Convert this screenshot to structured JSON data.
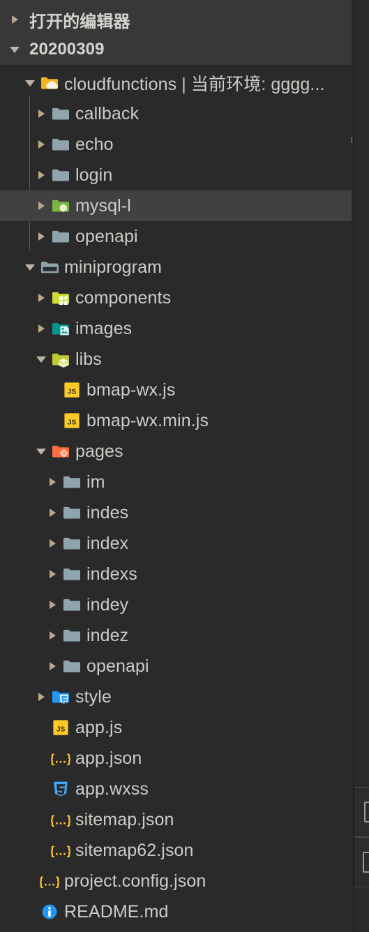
{
  "theme": {
    "sidebar_bg": "#2a2a2a",
    "header_bg": "#383838",
    "selected_bg": "#414141",
    "text": "#ccccc7",
    "guide": "#585858",
    "twisty": "#b9a88f"
  },
  "sections": [
    {
      "label": "打开的编辑器",
      "expanded": false
    },
    {
      "label": "20200309",
      "expanded": true
    }
  ],
  "tree": [
    {
      "label": "cloudfunctions | 当前环境: gggg...",
      "icon": "folder-cloud-icon",
      "state": "expanded",
      "depth": 1,
      "selected": false
    },
    {
      "label": "callback",
      "icon": "folder-icon",
      "state": "collapsed",
      "depth": 2,
      "selected": false
    },
    {
      "label": "echo",
      "icon": "folder-icon",
      "state": "collapsed",
      "depth": 2,
      "selected": false
    },
    {
      "label": "login",
      "icon": "folder-icon",
      "state": "collapsed",
      "depth": 2,
      "selected": false
    },
    {
      "label": "mysql-l",
      "icon": "folder-node-icon",
      "state": "collapsed",
      "depth": 2,
      "selected": true
    },
    {
      "label": "openapi",
      "icon": "folder-icon",
      "state": "collapsed",
      "depth": 2,
      "selected": false
    },
    {
      "label": "miniprogram",
      "icon": "folder-open-icon",
      "state": "expanded",
      "depth": 1,
      "selected": false
    },
    {
      "label": "components",
      "icon": "folder-components-icon",
      "state": "collapsed",
      "depth": 2,
      "selected": false
    },
    {
      "label": "images",
      "icon": "folder-images-icon",
      "state": "collapsed",
      "depth": 2,
      "selected": false
    },
    {
      "label": "libs",
      "icon": "folder-lib-icon",
      "state": "expanded",
      "depth": 2,
      "selected": false
    },
    {
      "label": "bmap-wx.js",
      "icon": "js-file-icon",
      "state": "none",
      "depth": 3,
      "selected": false
    },
    {
      "label": "bmap-wx.min.js",
      "icon": "js-file-icon",
      "state": "none",
      "depth": 3,
      "selected": false
    },
    {
      "label": "pages",
      "icon": "folder-views-icon",
      "state": "expanded",
      "depth": 2,
      "selected": false
    },
    {
      "label": "im",
      "icon": "folder-icon",
      "state": "collapsed",
      "depth": 3,
      "selected": false
    },
    {
      "label": "indes",
      "icon": "folder-icon",
      "state": "collapsed",
      "depth": 3,
      "selected": false
    },
    {
      "label": "index",
      "icon": "folder-icon",
      "state": "collapsed",
      "depth": 3,
      "selected": false
    },
    {
      "label": "indexs",
      "icon": "folder-icon",
      "state": "collapsed",
      "depth": 3,
      "selected": false
    },
    {
      "label": "indey",
      "icon": "folder-icon",
      "state": "collapsed",
      "depth": 3,
      "selected": false
    },
    {
      "label": "indez",
      "icon": "folder-icon",
      "state": "collapsed",
      "depth": 3,
      "selected": false
    },
    {
      "label": "openapi",
      "icon": "folder-icon",
      "state": "collapsed",
      "depth": 3,
      "selected": false
    },
    {
      "label": "style",
      "icon": "folder-css-icon",
      "state": "collapsed",
      "depth": 2,
      "selected": false
    },
    {
      "label": "app.js",
      "icon": "js-file-icon",
      "state": "none",
      "depth": 2,
      "selected": false
    },
    {
      "label": "app.json",
      "icon": "json-file-icon",
      "state": "none",
      "depth": 2,
      "selected": false
    },
    {
      "label": "app.wxss",
      "icon": "css-file-icon",
      "state": "none",
      "depth": 2,
      "selected": false
    },
    {
      "label": "sitemap.json",
      "icon": "json-file-icon",
      "state": "none",
      "depth": 2,
      "selected": false
    },
    {
      "label": "sitemap62.json",
      "icon": "json-file-icon",
      "state": "none",
      "depth": 2,
      "selected": false
    },
    {
      "label": "project.config.json",
      "icon": "json-file-icon",
      "state": "none",
      "depth": 1,
      "selected": false
    },
    {
      "label": "README.md",
      "icon": "markdown-info-icon",
      "state": "none",
      "depth": 1,
      "selected": false
    }
  ]
}
